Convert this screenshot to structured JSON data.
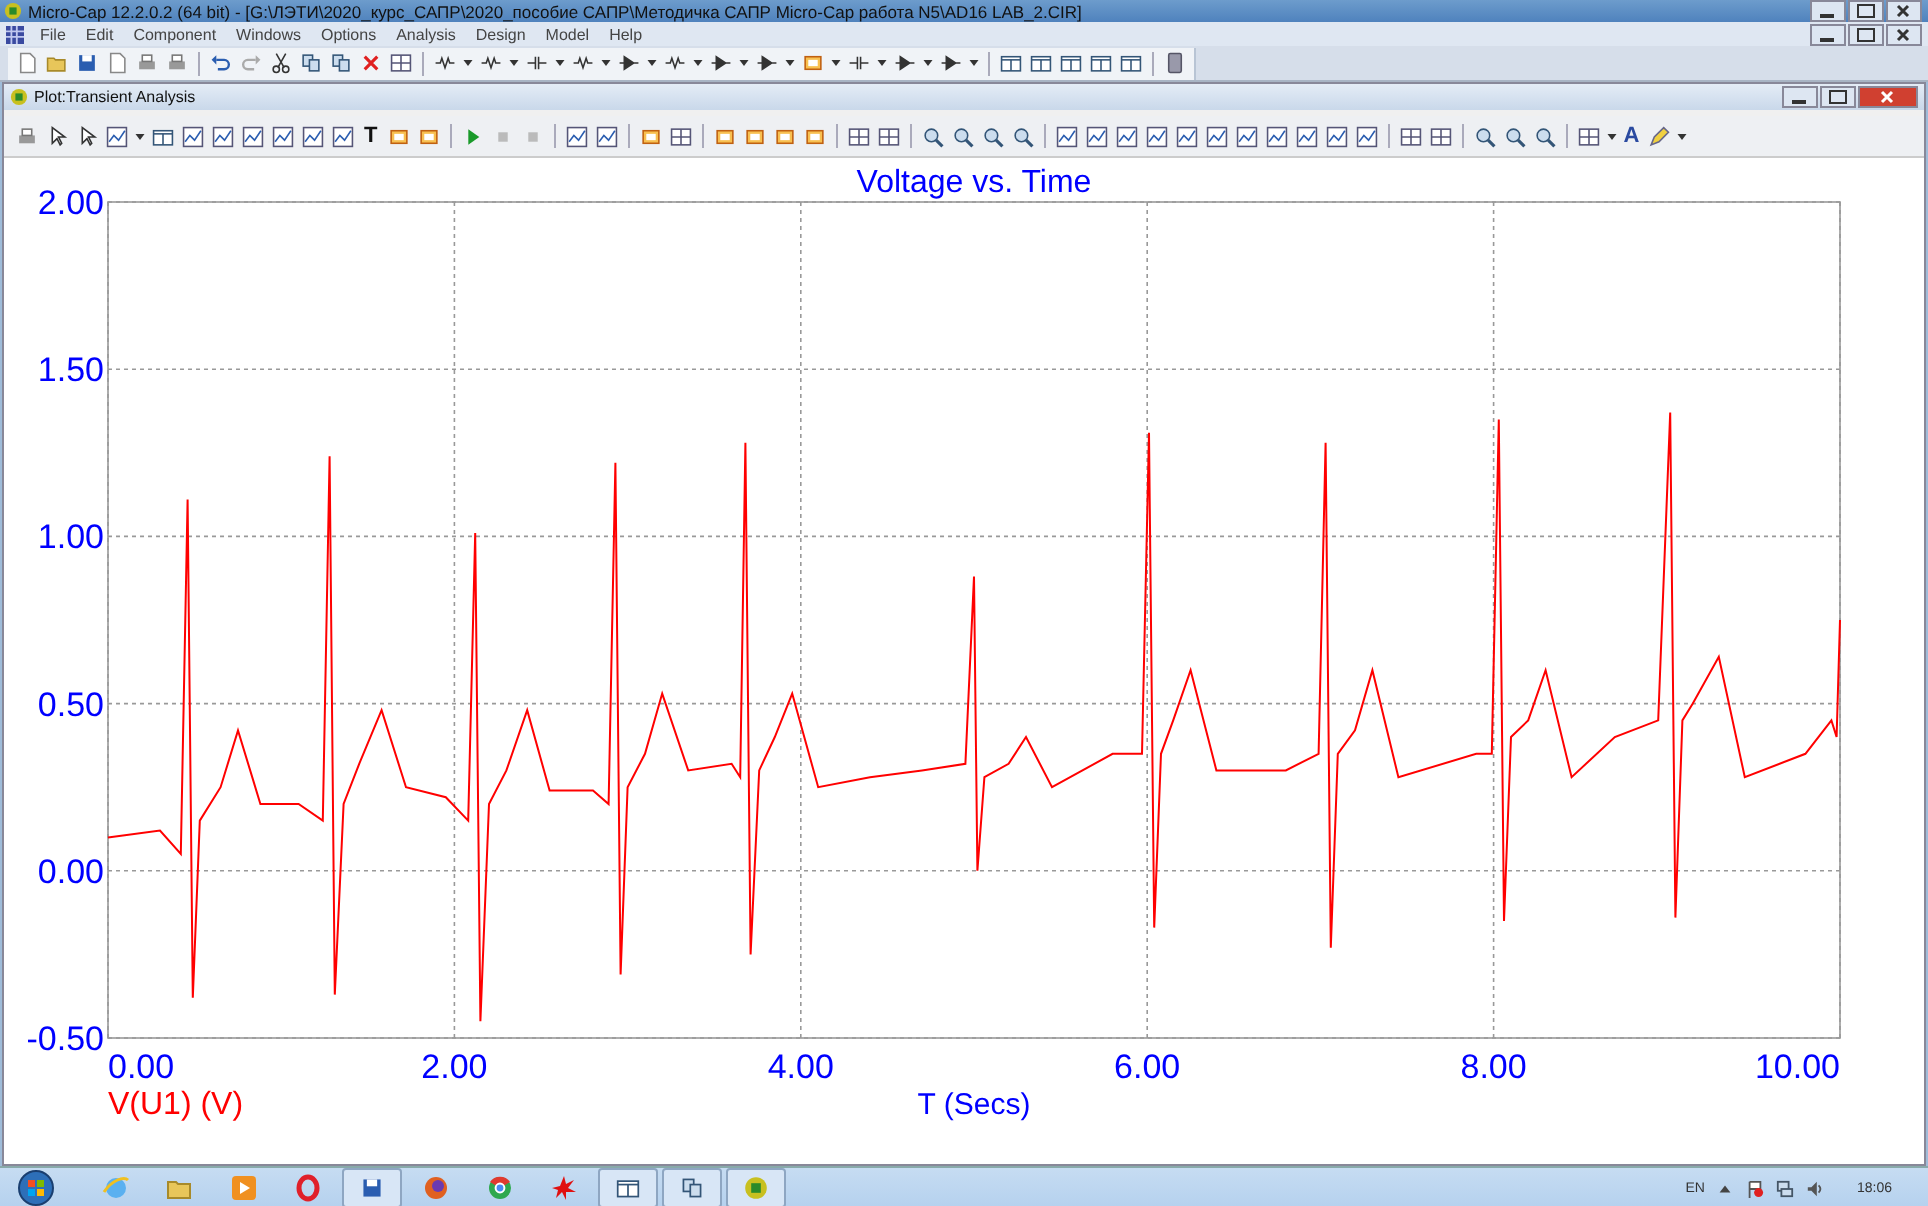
{
  "window": {
    "title": "Micro-Cap 12.2.0.2 (64 bit) - [G:\\ЛЭТИ\\2020_курс_САПР\\2020_пособие САПР\\Методичка САПР Micro-Cap работа N5\\AD16 LAB_2.CIR]"
  },
  "menu": [
    "File",
    "Edit",
    "Component",
    "Windows",
    "Options",
    "Analysis",
    "Design",
    "Model",
    "Help"
  ],
  "child_window": {
    "title": "Plot:Transient Analysis"
  },
  "plot_toolbar": {
    "text_button": "T",
    "font_button": "A"
  },
  "chart_data": {
    "type": "line",
    "title": "Voltage vs. Time",
    "xlabel": "T (Secs)",
    "grid": true,
    "xlim": [
      0,
      10
    ],
    "ylim": [
      -0.5,
      2
    ],
    "xticks": [
      {
        "value": 0,
        "label": "0.00"
      },
      {
        "value": 2,
        "label": "2.00"
      },
      {
        "value": 4,
        "label": "4.00"
      },
      {
        "value": 6,
        "label": "6.00"
      },
      {
        "value": 8,
        "label": "8.00"
      },
      {
        "value": 10,
        "label": "10.00"
      }
    ],
    "yticks": [
      {
        "value": -0.5,
        "label": "-0.50"
      },
      {
        "value": 0,
        "label": "0.00"
      },
      {
        "value": 0.5,
        "label": "0.50"
      },
      {
        "value": 1,
        "label": "1.00"
      },
      {
        "value": 1.5,
        "label": "1.50"
      },
      {
        "value": 2,
        "label": "2.00"
      }
    ],
    "x": [
      0,
      0.3,
      0.42,
      0.46,
      0.49,
      0.53,
      0.65,
      0.75,
      0.88,
      1.1,
      1.24,
      1.28,
      1.31,
      1.36,
      1.45,
      1.58,
      1.72,
      1.95,
      2.08,
      2.12,
      2.15,
      2.2,
      2.3,
      2.42,
      2.55,
      2.8,
      2.89,
      2.93,
      2.96,
      3.0,
      3.1,
      3.2,
      3.35,
      3.6,
      3.65,
      3.68,
      3.71,
      3.76,
      3.85,
      3.95,
      4.1,
      4.4,
      4.7,
      4.95,
      5.0,
      5.02,
      5.06,
      5.2,
      5.3,
      5.45,
      5.8,
      5.97,
      6.01,
      6.04,
      6.08,
      6.15,
      6.25,
      6.4,
      6.8,
      6.99,
      7.03,
      7.06,
      7.1,
      7.2,
      7.3,
      7.45,
      7.9,
      7.99,
      8.03,
      8.06,
      8.1,
      8.2,
      8.3,
      8.45,
      8.7,
      8.95,
      9.02,
      9.05,
      9.09,
      9.15,
      9.3,
      9.45,
      9.8,
      9.95,
      9.98,
      10.0
    ],
    "series": [
      {
        "name": "V(U1) (V)",
        "color": "#ff0000",
        "values": [
          0.1,
          0.12,
          0.05,
          1.11,
          -0.38,
          0.15,
          0.25,
          0.42,
          0.2,
          0.2,
          0.15,
          1.24,
          -0.37,
          0.2,
          0.32,
          0.48,
          0.25,
          0.22,
          0.15,
          1.01,
          -0.45,
          0.2,
          0.3,
          0.48,
          0.24,
          0.24,
          0.2,
          1.22,
          -0.31,
          0.25,
          0.35,
          0.53,
          0.3,
          0.32,
          0.28,
          1.28,
          -0.25,
          0.3,
          0.4,
          0.53,
          0.25,
          0.28,
          0.3,
          0.32,
          0.88,
          0.0,
          0.28,
          0.32,
          0.4,
          0.25,
          0.35,
          0.35,
          1.31,
          -0.17,
          0.35,
          0.45,
          0.6,
          0.3,
          0.3,
          0.35,
          1.28,
          -0.23,
          0.35,
          0.42,
          0.6,
          0.28,
          0.35,
          0.35,
          1.35,
          -0.15,
          0.4,
          0.45,
          0.6,
          0.28,
          0.4,
          0.45,
          1.37,
          -0.14,
          0.45,
          0.5,
          0.64,
          0.28,
          0.35,
          0.45,
          0.4,
          0.75
        ]
      }
    ]
  },
  "taskbar": {
    "language": "EN",
    "clock": "18:06"
  }
}
